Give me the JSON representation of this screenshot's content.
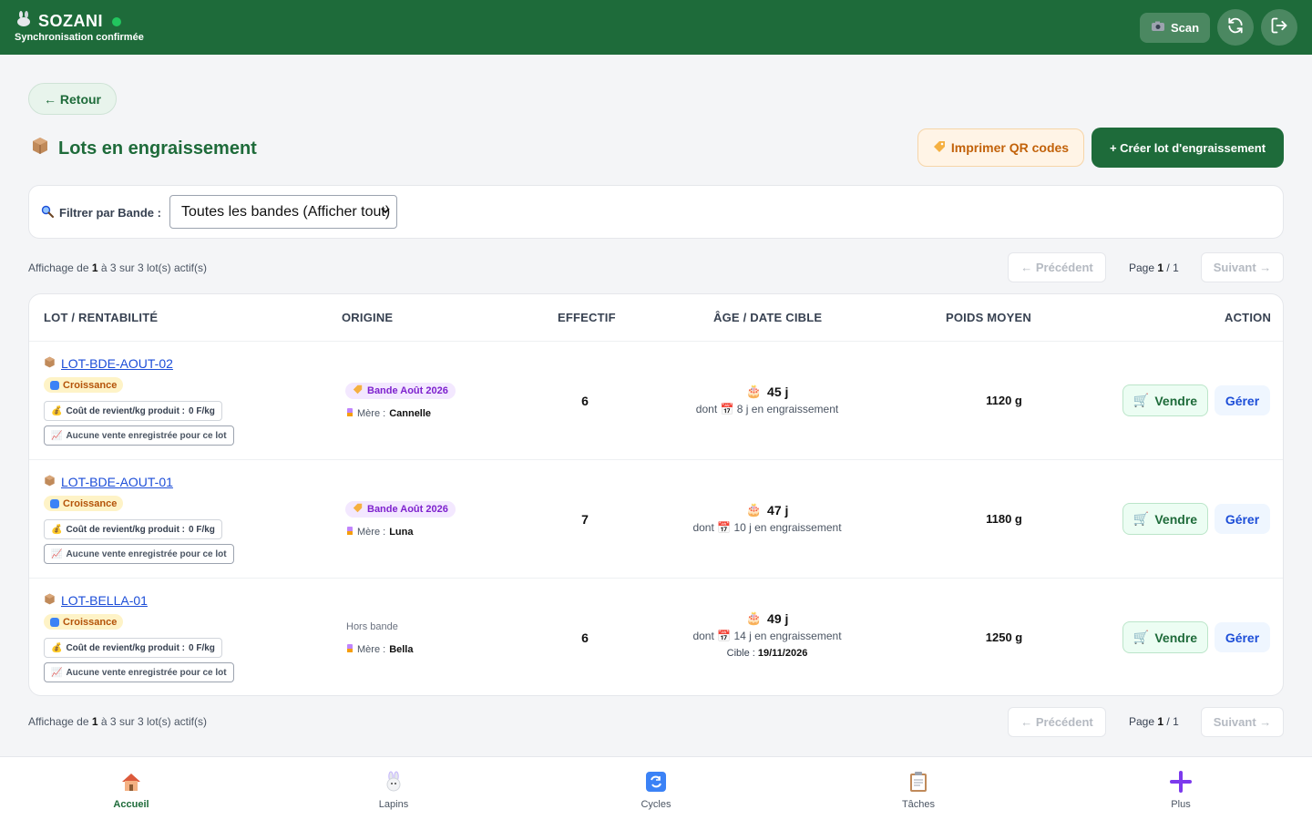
{
  "header": {
    "app_name": "SOZANI",
    "sync_status": "Synchronisation confirmée",
    "scan_label": "Scan"
  },
  "back_label": "← Retour",
  "page": {
    "title": "Lots en engraissement",
    "print_qr_label": "Imprimer QR codes",
    "create_label": "+ Créer lot d'engraissement"
  },
  "filter": {
    "label": "Filtrer par Bande :",
    "selected": "Toutes les bandes (Afficher tout)"
  },
  "pagination": {
    "info_prefix": "Affichage de",
    "from": "1",
    "to_word": "à",
    "to": "3",
    "of_word": "sur",
    "total": "3",
    "suffix": "lot(s) actif(s)",
    "prev": "← Précédent",
    "next": "Suivant →",
    "page_word": "Page",
    "page_current": "1",
    "page_total": "/ 1"
  },
  "table": {
    "headers": {
      "lot": "LOT / RENTABILITÉ",
      "origine": "ORIGINE",
      "effectif": "EFFECTIF",
      "age": "ÂGE / DATE CIBLE",
      "poids": "POIDS MOYEN",
      "action": "ACTION"
    },
    "rows": [
      {
        "lot": "LOT-BDE-AOUT-02",
        "status": "Croissance",
        "cost_label": "Coût de revient/kg produit :",
        "cost_value": "0 F/kg",
        "no_sale": "Aucune vente enregistrée pour ce lot",
        "bande": "Bande Août 2026",
        "mere_label": "Mère :",
        "mere": "Cannelle",
        "effectif": "6",
        "age": "45 j",
        "dont_word": "dont",
        "engraissement": "8 j en engraissement",
        "poids": "1120 g",
        "vendre": "Vendre",
        "gerer": "Gérer"
      },
      {
        "lot": "LOT-BDE-AOUT-01",
        "status": "Croissance",
        "cost_label": "Coût de revient/kg produit :",
        "cost_value": "0 F/kg",
        "no_sale": "Aucune vente enregistrée pour ce lot",
        "bande": "Bande Août 2026",
        "mere_label": "Mère :",
        "mere": "Luna",
        "effectif": "7",
        "age": "47 j",
        "dont_word": "dont",
        "engraissement": "10 j en engraissement",
        "poids": "1180 g",
        "vendre": "Vendre",
        "gerer": "Gérer"
      },
      {
        "lot": "LOT-BELLA-01",
        "status": "Croissance",
        "cost_label": "Coût de revient/kg produit :",
        "cost_value": "0 F/kg",
        "no_sale": "Aucune vente enregistrée pour ce lot",
        "hors_bande": "Hors bande",
        "mere_label": "Mère :",
        "mere": "Bella",
        "effectif": "6",
        "age": "49 j",
        "dont_word": "dont",
        "engraissement": "14 j en engraissement",
        "cible_label": "Cible :",
        "cible": "19/11/2026",
        "poids": "1250 g",
        "vendre": "Vendre",
        "gerer": "Gérer"
      }
    ]
  },
  "nav": [
    {
      "label": "Accueil",
      "icon": "house-icon"
    },
    {
      "label": "Lapins",
      "icon": "rabbit-icon"
    },
    {
      "label": "Cycles",
      "icon": "cycle-icon"
    },
    {
      "label": "Tâches",
      "icon": "clipboard-icon"
    },
    {
      "label": "Plus",
      "icon": "plus-icon"
    }
  ],
  "colors": {
    "brand_green": "#1e6b3a",
    "link_blue": "#1d4ed8",
    "badge_yellow": "#fef3c7",
    "bande_purple": "#f3e8ff",
    "qr_orange": "#c2620a"
  }
}
